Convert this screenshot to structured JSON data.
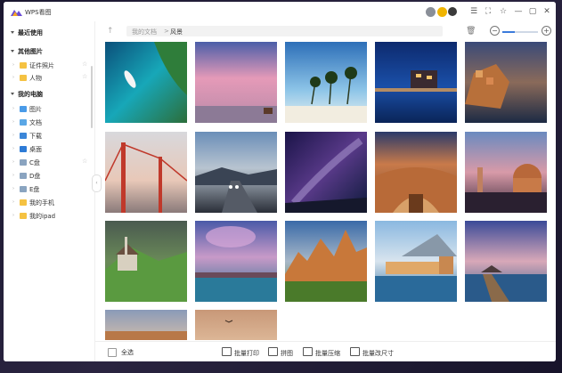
{
  "app": {
    "title": "WPS看图"
  },
  "titlebar_icons": [
    "menu-icon",
    "fullscreen-icon",
    "pin-icon",
    "minimize-icon",
    "maximize-icon",
    "close-icon"
  ],
  "sidebar": {
    "recent_label": "最近使用",
    "folders_label": "其他图片",
    "folder_items": [
      {
        "label": "证件照片"
      },
      {
        "label": "人物"
      }
    ],
    "computer_label": "我的电脑",
    "computer_items": [
      {
        "label": "图片"
      },
      {
        "label": "文档"
      },
      {
        "label": "下载"
      },
      {
        "label": "桌面"
      },
      {
        "label": "C盘"
      },
      {
        "label": "D盘"
      },
      {
        "label": "E盘"
      },
      {
        "label": "我的手机"
      },
      {
        "label": "我的ipad"
      }
    ]
  },
  "toolbar": {
    "breadcrumb": [
      "我的文档",
      "风景"
    ],
    "breadcrumb_sep": ">",
    "zoom_level": 0.35
  },
  "thumbnails": [
    {
      "name": "aerial-beach-boat"
    },
    {
      "name": "pink-sky-lake"
    },
    {
      "name": "palm-beach"
    },
    {
      "name": "night-city-harbor"
    },
    {
      "name": "coastal-village"
    },
    {
      "name": "golden-gate-bridge"
    },
    {
      "name": "mountain-road-night"
    },
    {
      "name": "milky-way"
    },
    {
      "name": "piazza-dome"
    },
    {
      "name": "florence-duomo"
    },
    {
      "name": "alpine-church"
    },
    {
      "name": "dusk-lake-town"
    },
    {
      "name": "dolomites-peaks"
    },
    {
      "name": "lake-palace"
    },
    {
      "name": "pier-sunset"
    },
    {
      "name": "sunset-clouds"
    },
    {
      "name": "warm-sky-bird"
    }
  ],
  "bottombar": {
    "select_all": "全选",
    "actions": [
      {
        "label": "批量打印"
      },
      {
        "label": "拼图"
      },
      {
        "label": "批量压缩"
      },
      {
        "label": "批量改尺寸"
      }
    ]
  }
}
